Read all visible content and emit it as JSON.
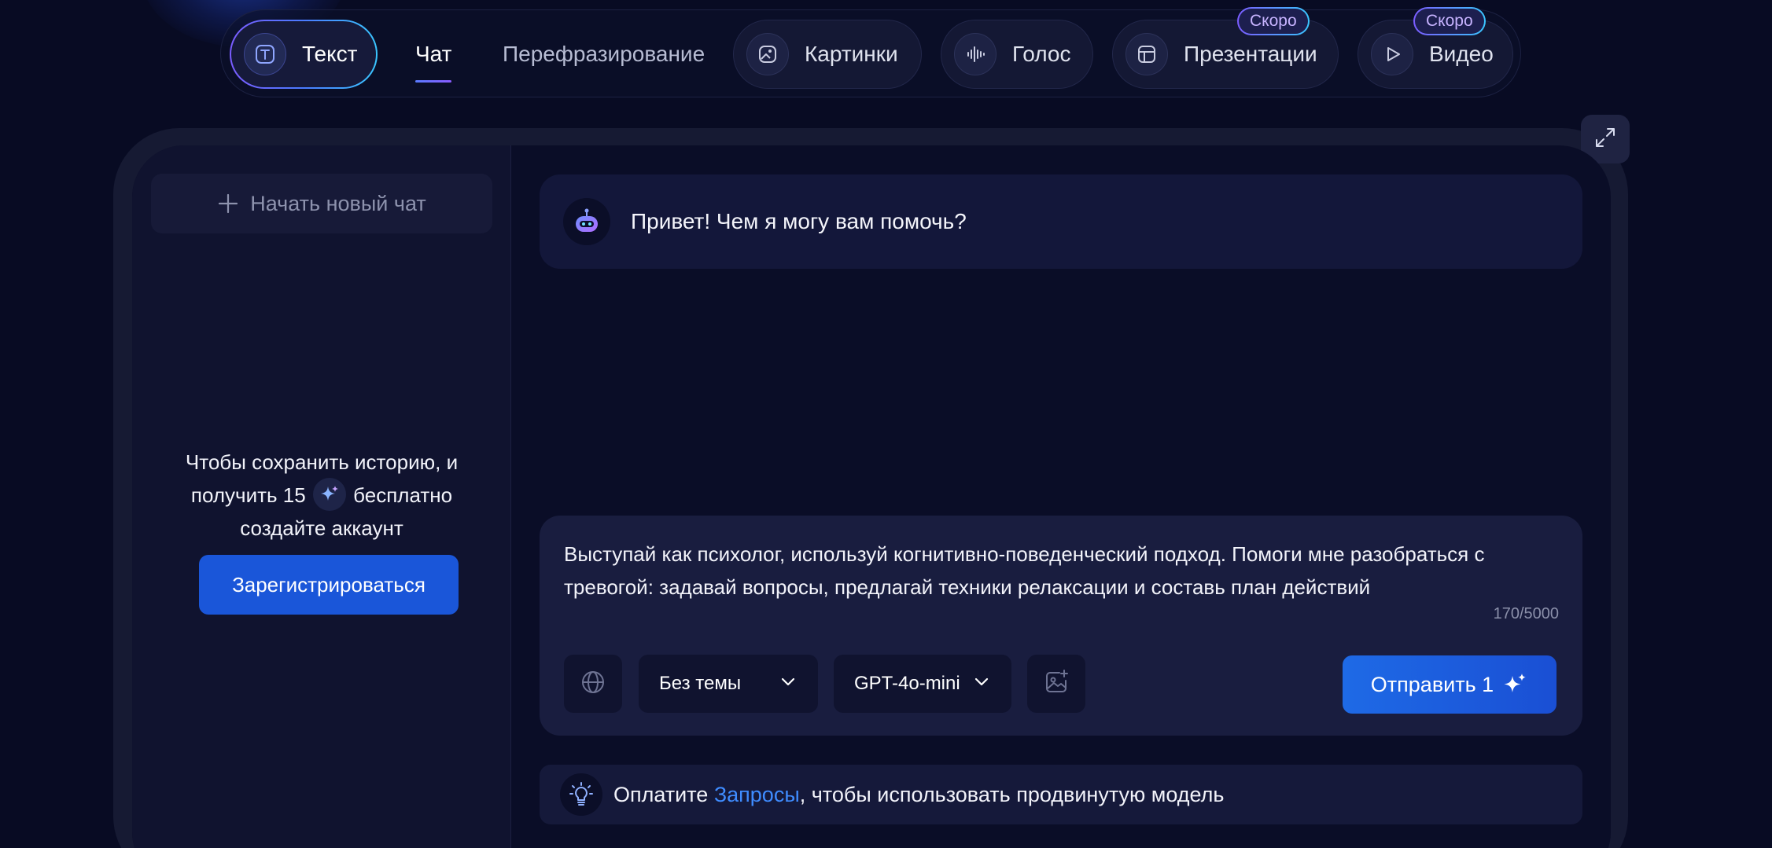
{
  "nav": {
    "tabs": [
      {
        "label": "Текст",
        "icon": "text-t-icon",
        "active": true
      },
      {
        "label": "Чат",
        "active": true
      },
      {
        "label": "Перефразирование"
      },
      {
        "label": "Картинки",
        "icon": "image-icon"
      },
      {
        "label": "Голос",
        "icon": "waveform-icon"
      },
      {
        "label": "Презентации",
        "icon": "presentation-icon",
        "badge": "Скоро"
      },
      {
        "label": "Видео",
        "icon": "play-icon",
        "badge": "Скоро"
      }
    ]
  },
  "sidebar": {
    "new_chat": "Начать новый чат",
    "promo": {
      "line1": "Чтобы сохранить историю, и",
      "line2_before": "получить 15",
      "line2_after": "бесплатно",
      "line3": "создайте аккаунт"
    },
    "register": "Зарегистрироваться"
  },
  "chat": {
    "greeting": "Привет! Чем я могу вам помочь?"
  },
  "composer": {
    "prompt": "Выступай как психолог, используй когнитивно-поведенческий подход. Помоги мне разобраться с тревогой: задавай вопросы, предлагай техники релаксации и составь план действий",
    "counter": "170/5000",
    "theme": "Без темы",
    "model": "GPT-4o-mini",
    "send": "Отправить 1"
  },
  "upsell": {
    "before": "Оплатите",
    "link": "Запросы",
    "after": ", чтобы использовать продвинутую модель"
  },
  "colors": {
    "background": "#080b23",
    "accent": "#1a56d9",
    "link": "#3f8cff",
    "badge_text": "#c7b3ff"
  }
}
